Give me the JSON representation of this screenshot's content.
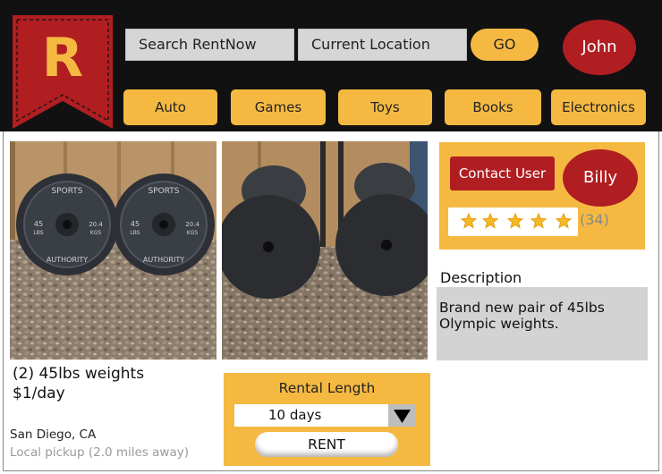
{
  "header": {
    "logo_letter": "R",
    "search_placeholder": "Search RentNow",
    "location_placeholder": "Current Location",
    "go_label": "GO",
    "user_name": "John",
    "categories": [
      "Auto",
      "Games",
      "Toys",
      "Books",
      "Electronics"
    ]
  },
  "listing": {
    "title": "(2) 45lbs weights",
    "price": "$1/day",
    "city": "San Diego, CA",
    "pickup": "Local pickup (2.0 miles away)",
    "plate_text": {
      "brand_top": "SPORTS",
      "brand_bottom": "AUTHORITY",
      "weight_lbs_num": "45",
      "weight_lbs_unit": "LBS",
      "weight_kgs_num": "20.4",
      "weight_kgs_unit": "KGS"
    }
  },
  "rental": {
    "title": "Rental Length",
    "selected_days": "10 days",
    "rent_label": "RENT"
  },
  "owner": {
    "contact_label": "Contact User",
    "name": "Billy",
    "stars": 5,
    "review_count": "(34)"
  },
  "description": {
    "heading": "Description",
    "text": "Brand new pair of 45lbs Olympic weights."
  },
  "colors": {
    "accent_yellow": "#f5b942",
    "accent_red": "#b01e22",
    "header_bg": "#111111",
    "input_gray": "#d6d6d6"
  }
}
